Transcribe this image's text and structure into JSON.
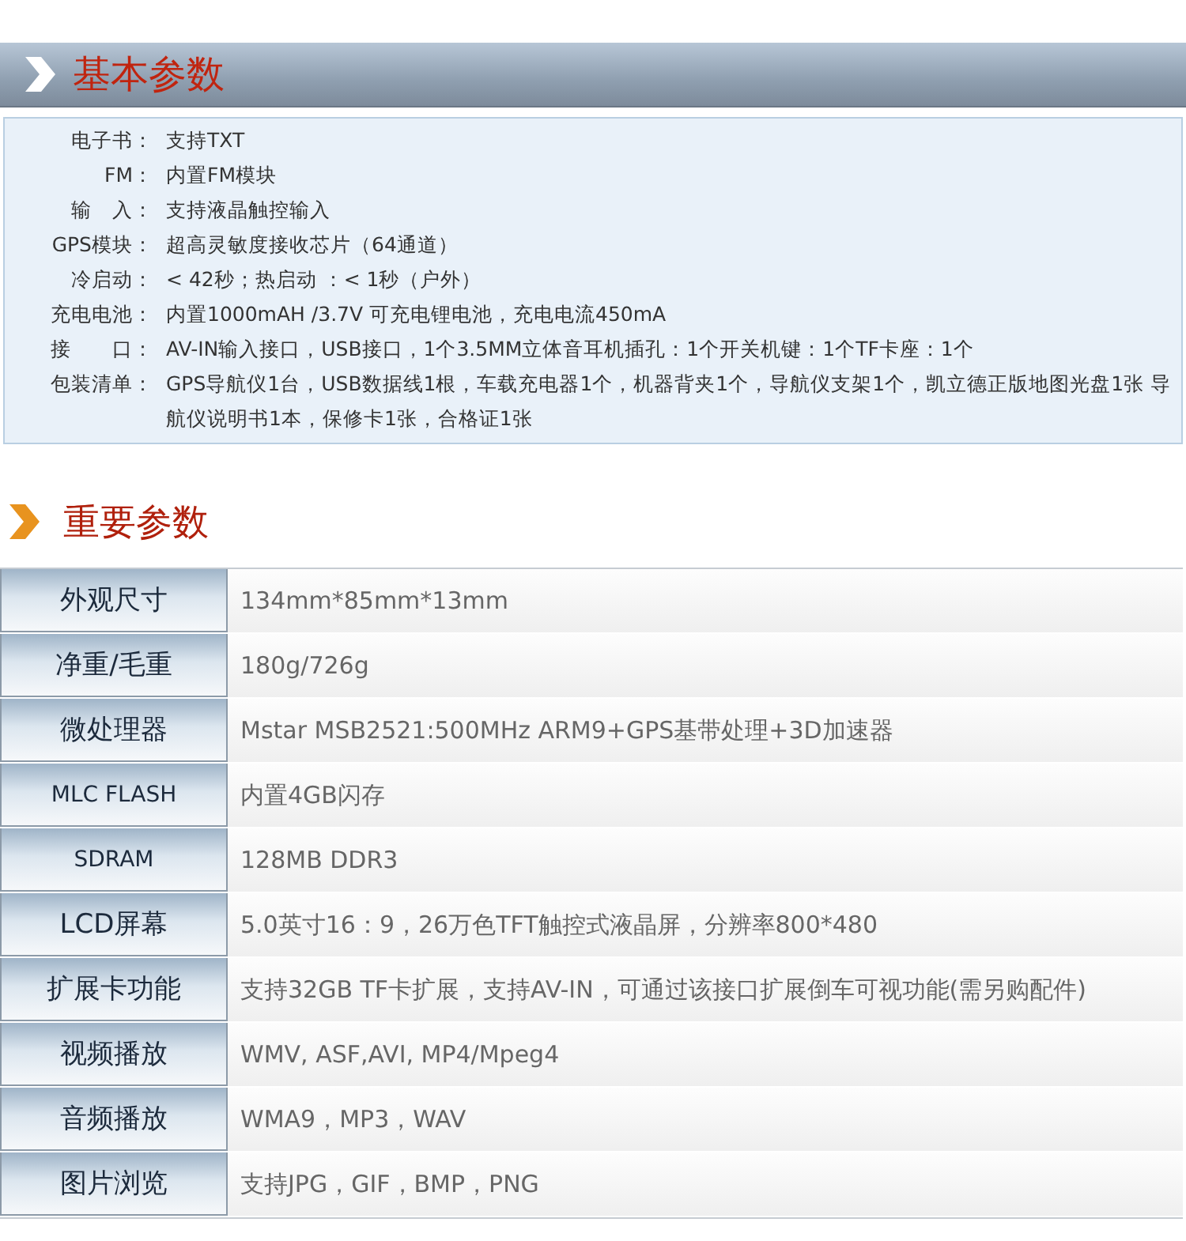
{
  "basic_section": {
    "title": "基本参数",
    "rows": [
      {
        "label": "电子书：",
        "value": "支持TXT"
      },
      {
        "label": "FM：",
        "value": "内置FM模块"
      },
      {
        "label": "输　入：",
        "value": "支持液晶触控输入"
      },
      {
        "label": "GPS模块：",
        "value": "超高灵敏度接收芯片（64通道）"
      },
      {
        "label": "冷启动：",
        "value": "< 42秒；热启动 ：< 1秒（户外）"
      },
      {
        "label": "充电电池：",
        "value": "内置1000mAH /3.7V 可充电锂电池，充电电流450mA"
      },
      {
        "label": "接　　口：",
        "value": "AV-IN输入接口，USB接口，1个3.5MM立体音耳机插孔：1个开关机键：1个TF卡座：1个"
      },
      {
        "label": "包装清单：",
        "value": "GPS导航仪1台，USB数据线1根，车载充电器1个，机器背夹1个，导航仪支架1个，凯立德正版地图光盘1张 导航仪说明书1本，保修卡1张，合格证1张"
      }
    ]
  },
  "key_section": {
    "title": "重要参数",
    "rows": [
      {
        "label": "外观尺寸",
        "value": "134mm*85mm*13mm"
      },
      {
        "label": "净重/毛重",
        "value": "180g/726g"
      },
      {
        "label": "微处理器",
        "value": "Mstar MSB2521:500MHz ARM9+GPS基带处理+3D加速器"
      },
      {
        "label": "MLC FLASH",
        "value": "内置4GB闪存"
      },
      {
        "label": "SDRAM",
        "value": "128MB DDR3"
      },
      {
        "label": "LCD屏幕",
        "value": "5.0英寸16：9，26万色TFT触控式液晶屏，分辨率800*480"
      },
      {
        "label": "扩展卡功能",
        "value": "支持32GB TF卡扩展，支持AV-IN，可通过该接口扩展倒车可视功能(需另购配件)"
      },
      {
        "label": "视频播放",
        "value": "WMV, ASF,AVI, MP4/Mpeg4"
      },
      {
        "label": "音频播放",
        "value": "WMA9，MP3，WAV"
      },
      {
        "label": "图片浏览",
        "value": "支持JPG，GIF，BMP，PNG"
      }
    ]
  }
}
